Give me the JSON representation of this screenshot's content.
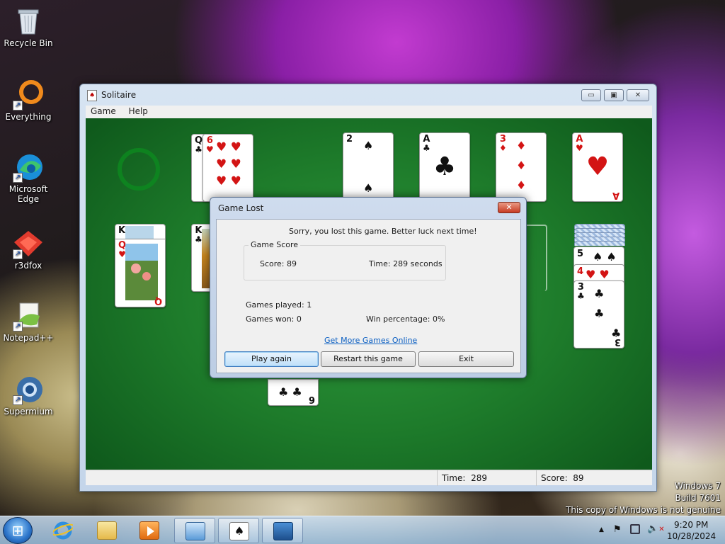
{
  "desktop": {
    "icons": [
      {
        "name": "Recycle Bin"
      },
      {
        "name": "Everything"
      },
      {
        "name": "Microsoft Edge"
      },
      {
        "name": "r3dfox"
      },
      {
        "name": "Notepad++"
      },
      {
        "name": "Supermium"
      }
    ],
    "watermark": {
      "line1": "Windows 7",
      "line2": "Build 7601",
      "line3": "This copy of Windows is not genuine"
    }
  },
  "window": {
    "title": "Solitaire",
    "menu": [
      "Game",
      "Help"
    ],
    "controls": {
      "minimize": "▭",
      "maximize": "▣",
      "close": "✕"
    },
    "status": {
      "time_label": "Time:",
      "time_value": "289",
      "score_label": "Score:",
      "score_value": "89"
    }
  },
  "board": {
    "foundations": [
      {
        "rank": "2",
        "suit": "♠",
        "color": "black"
      },
      {
        "rank": "A",
        "suit": "♣",
        "color": "black"
      },
      {
        "rank": "3",
        "suit": "♦",
        "color": "red"
      },
      {
        "rank": "A",
        "suit": "♥",
        "color": "red"
      }
    ],
    "waste": {
      "under_rank": "Q",
      "under_suit": "♣",
      "top_rank": "6",
      "top_suit": "♥"
    },
    "tableau_left": {
      "king_rank": "K",
      "king_suit": "♠",
      "queen_rank": "Q",
      "queen_suit": "♥",
      "queen_bottom": "Q"
    },
    "tableau_second": {
      "rank": "K",
      "suit": "♣"
    },
    "tableau_right": {
      "cards": [
        {
          "rank": "5",
          "suit": "♠",
          "color": "black"
        },
        {
          "rank": "4",
          "suit": "♥",
          "color": "red"
        },
        {
          "rank": "3",
          "suit": "♣",
          "color": "black"
        }
      ],
      "bottom_rank": "3"
    },
    "bottom_card": {
      "suit": "♣",
      "bottom_rank": "6"
    }
  },
  "dialog": {
    "title": "Game Lost",
    "close": "✕",
    "message": "Sorry, you lost this game. Better luck next time!",
    "score_group": "Game Score",
    "score": "Score: 89",
    "time": "Time:  289 seconds",
    "games_played": "Games played: 1",
    "games_won": "Games won: 0",
    "win_percentage": "Win percentage: 0%",
    "link": "Get More Games Online",
    "buttons": {
      "play_again": "Play again",
      "restart": "Restart this game",
      "exit": "Exit"
    }
  },
  "taskbar": {
    "start": "⊞",
    "clock_time": "9:20 PM",
    "clock_date": "10/28/2024",
    "tray_icons": [
      "show-hidden-icon",
      "flag-icon",
      "network-icon",
      "volume-muted-icon"
    ]
  },
  "colors": {
    "felt": "#1d7a2a",
    "link": "#0b5fc2",
    "red_suit": "#d31414"
  }
}
